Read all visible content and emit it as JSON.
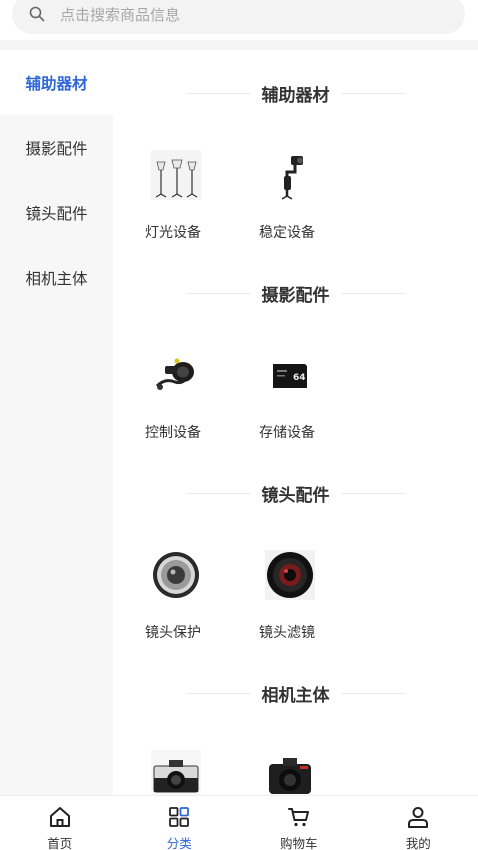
{
  "search": {
    "placeholder": "点击搜索商品信息"
  },
  "sidebar": {
    "items": [
      {
        "label": "辅助器材",
        "active": true
      },
      {
        "label": "摄影配件",
        "active": false
      },
      {
        "label": "镜头配件",
        "active": false
      },
      {
        "label": "相机主体",
        "active": false
      }
    ]
  },
  "sections": [
    {
      "title": "辅助器材",
      "items": [
        {
          "label": "灯光设备",
          "icon": "lighting-kit-image"
        },
        {
          "label": "稳定设备",
          "icon": "gimbal-stabilizer-image"
        }
      ]
    },
    {
      "title": "摄影配件",
      "items": [
        {
          "label": "控制设备",
          "icon": "follow-focus-image"
        },
        {
          "label": "存储设备",
          "icon": "sd-card-image"
        }
      ]
    },
    {
      "title": "镜头配件",
      "items": [
        {
          "label": "镜头保护",
          "icon": "lens-protector-image"
        },
        {
          "label": "镜头滤镜",
          "icon": "lens-filter-image"
        }
      ]
    },
    {
      "title": "相机主体",
      "items": [
        {
          "label": "",
          "icon": "film-camera-image"
        },
        {
          "label": "",
          "icon": "dslr-camera-image"
        }
      ]
    }
  ],
  "tabbar": {
    "items": [
      {
        "label": "首页",
        "icon": "home-icon",
        "active": false
      },
      {
        "label": "分类",
        "icon": "category-icon",
        "active": true
      },
      {
        "label": "购物车",
        "icon": "cart-icon",
        "active": false
      },
      {
        "label": "我的",
        "icon": "user-icon",
        "active": false
      }
    ]
  },
  "colors": {
    "accent": "#2f67d8",
    "sidebar_bg": "#f7f7f7",
    "text": "#333333"
  },
  "sd_card_text": "64"
}
